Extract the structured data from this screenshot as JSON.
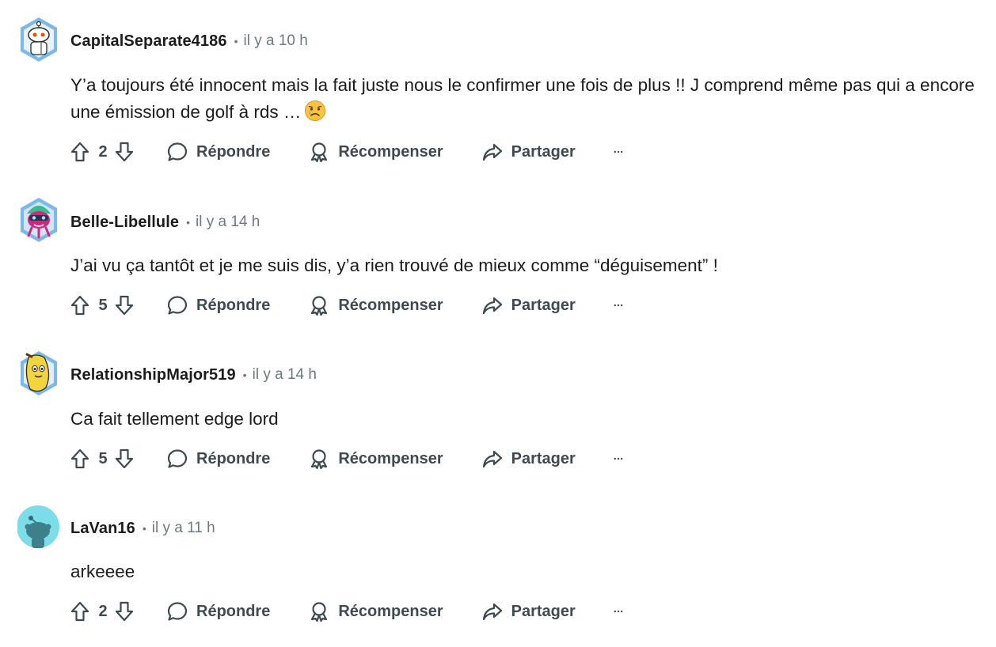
{
  "actions": {
    "reply_label": "Répondre",
    "award_label": "Récompenser",
    "share_label": "Partager"
  },
  "comments": [
    {
      "username": "CapitalSeparate4186",
      "separator": "•",
      "time": "il y a 10 h",
      "text": "Y’a toujours été innocent mais la fait juste nous le confirmer une fois de plus !! J comprend même pas qui a encore une émission de golf à rds …",
      "emoji": "sad-face-emoji",
      "votes": "2",
      "avatar": "snoo-avatar-robot"
    },
    {
      "username": "Belle-Libellule",
      "separator": "•",
      "time": "il y a 14 h",
      "text": "J’ai vu ça tantôt et je me suis dis, y’a rien trouvé de mieux comme “déguisement” !",
      "votes": "5",
      "avatar": "snoo-avatar-pink"
    },
    {
      "username": "RelationshipMajor519",
      "separator": "•",
      "time": "il y a 14 h",
      "text": "Ca fait tellement edge lord",
      "votes": "5",
      "avatar": "snoo-avatar-banana"
    },
    {
      "username": "LaVan16",
      "separator": "•",
      "time": "il y a 11 h",
      "text": "arkeeee",
      "votes": "2",
      "avatar": "snoo-avatar-default"
    }
  ],
  "colors": {
    "text": "#1c1c1c",
    "muted": "#6b7a80",
    "action": "#3f4a50",
    "avatar_hex_bg": "#6fb0e0",
    "avatar_default_bg": "#7cdce8"
  }
}
